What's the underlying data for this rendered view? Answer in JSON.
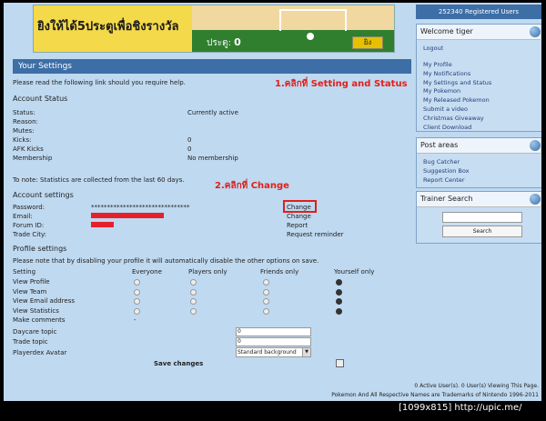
{
  "banner": {
    "text": "ยิงให้ได้5ประตูเพื่อชิงรางวัล",
    "score_label": "ประตู:",
    "score_value": "0",
    "button": "ยิง"
  },
  "main": {
    "header": "Your Settings",
    "help_text": "Please read the following link should you require help.",
    "annot1": "1.คลิกที่   Setting and Status",
    "annot2": "2.คลิกที่   Change",
    "account_status": {
      "title": "Account Status",
      "rows": [
        {
          "label": "Status:",
          "value": "Currently active"
        },
        {
          "label": "Reason:",
          "value": ""
        },
        {
          "label": "Mutes:",
          "value": ""
        },
        {
          "label": "Kicks:",
          "value": "0"
        },
        {
          "label": "AFK Kicks",
          "value": "0"
        },
        {
          "label": "Membership",
          "value": "No membership"
        }
      ]
    },
    "stats_note": "To note: Statistics are collected from the last 60 days.",
    "account_settings": {
      "title": "Account settings",
      "rows": [
        {
          "label": "Password:",
          "value": "*******************************",
          "action": "Change"
        },
        {
          "label": "Email:",
          "value": "",
          "action": "Change"
        },
        {
          "label": "Forum ID:",
          "value": "",
          "action": "Report"
        },
        {
          "label": "Trade City:",
          "value": "",
          "action": "Request reminder"
        }
      ]
    },
    "profile_settings": {
      "title": "Profile settings",
      "note": "Please note that by disabling your profile it will automatically disable the other options on save.",
      "columns": [
        "Setting",
        "Everyone",
        "Players only",
        "Friends only",
        "Yourself only"
      ],
      "rows": [
        {
          "label": "View Profile",
          "selected": 3
        },
        {
          "label": "View Team",
          "selected": 3
        },
        {
          "label": "View Email address",
          "selected": 3
        },
        {
          "label": "View Statistics",
          "selected": 3
        },
        {
          "label": "Make comments",
          "selected": -1
        }
      ],
      "make_comments_everyone": "-",
      "daycare_label": "Daycare topic",
      "daycare_value": "0",
      "trade_label": "Trade topic",
      "trade_value": "0",
      "avatar_label": "Playerdex Avatar",
      "avatar_value": "Standard background",
      "save_label": "Save changes"
    }
  },
  "sidebar": {
    "registered": "252340 Registered Users",
    "welcome": "Welcome tiger",
    "logout": "Logout",
    "links": [
      "My Profile",
      "My Notifications",
      "My Settings and Status",
      "My Pokemon",
      "My Released Pokemon",
      "Submit a video",
      "Christmas Giveaway",
      "Client Download"
    ],
    "post_areas": "Post areas",
    "post_links": [
      "Bug Catcher",
      "Suggestion Box",
      "Report Center"
    ],
    "trainer_search": "Trainer Search",
    "search_button": "Search"
  },
  "footer": {
    "line1": "0 Active User(s). 0 User(s) Viewing This Page.",
    "line2": "Pokemon And All Respective Names are Trademarks of Nintendo 1996-2011"
  },
  "watermark": "[1099x815] http://upic.me/",
  "colors": {
    "header": "#3d6ea6",
    "background": "#bfd9f0",
    "annotation": "#e0201a"
  }
}
